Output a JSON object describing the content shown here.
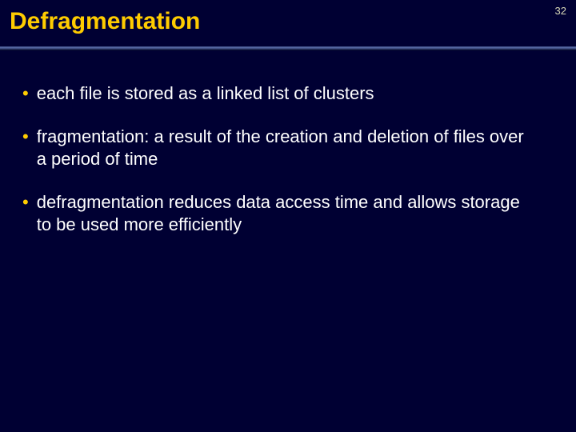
{
  "page_number": "32",
  "title": "Defragmentation",
  "bullets": [
    "each file is stored as a linked list of clusters",
    "fragmentation: a result of the creation and deletion of files over a period of time",
    "defragmentation reduces data access time and allows storage to be used more efficiently"
  ]
}
